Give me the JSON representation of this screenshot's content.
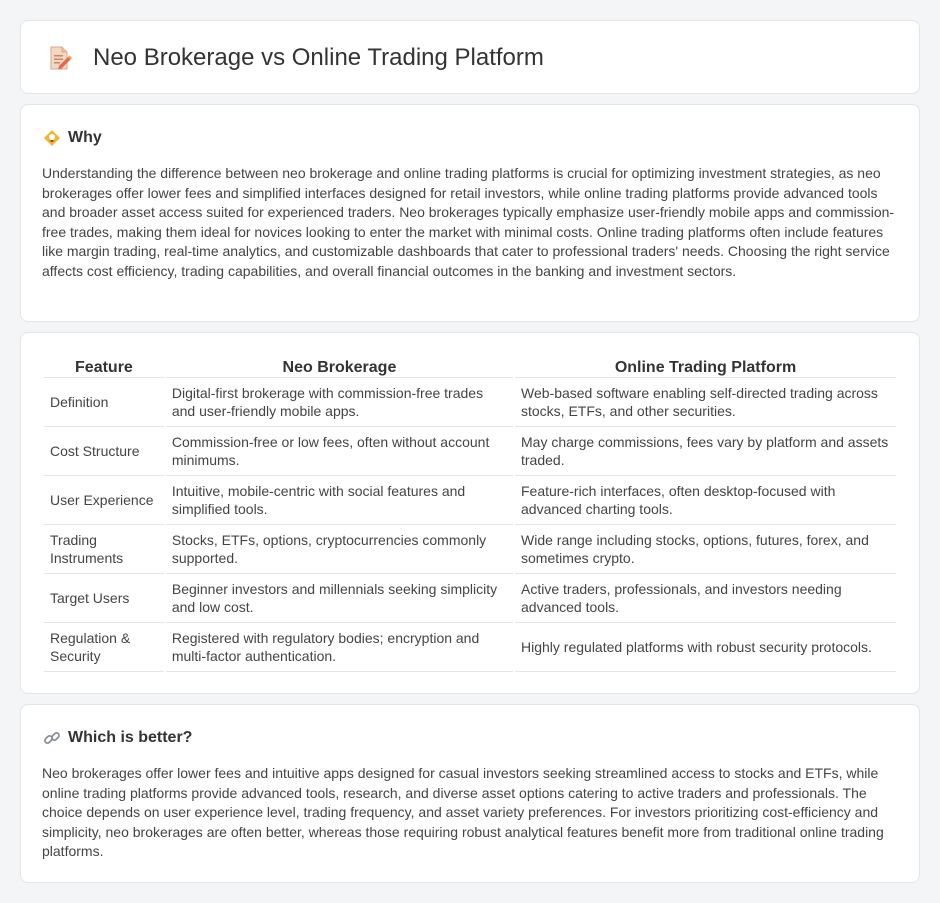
{
  "header": {
    "title": "Neo Brokerage vs Online Trading Platform",
    "icon": "document-edit-icon"
  },
  "why": {
    "heading": "Why",
    "icon": "bulb-icon",
    "text": "Understanding the difference between neo brokerage and online trading platforms is crucial for optimizing investment strategies, as neo brokerages offer lower fees and simplified interfaces designed for retail investors, while online trading platforms provide advanced tools and broader asset access suited for experienced traders. Neo brokerages typically emphasize user-friendly mobile apps and commission-free trades, making them ideal for novices looking to enter the market with minimal costs. Online trading platforms often include features like margin trading, real-time analytics, and customizable dashboards that cater to professional traders' needs. Choosing the right service affects cost efficiency, trading capabilities, and overall financial outcomes in the banking and investment sectors."
  },
  "table": {
    "columns": [
      "Feature",
      "Neo Brokerage",
      "Online Trading Platform"
    ],
    "rows": [
      [
        "Definition",
        "Digital-first brokerage with commission-free trades and user-friendly mobile apps.",
        "Web-based software enabling self-directed trading across stocks, ETFs, and other securities."
      ],
      [
        "Cost Structure",
        "Commission-free or low fees, often without account minimums.",
        "May charge commissions, fees vary by platform and assets traded."
      ],
      [
        "User Experience",
        "Intuitive, mobile-centric with social features and simplified tools.",
        "Feature-rich interfaces, often desktop-focused with advanced charting tools."
      ],
      [
        "Trading Instruments",
        "Stocks, ETFs, options, cryptocurrencies commonly supported.",
        "Wide range including stocks, options, futures, forex, and sometimes crypto."
      ],
      [
        "Target Users",
        "Beginner investors and millennials seeking simplicity and low cost.",
        "Active traders, professionals, and investors needing advanced tools."
      ],
      [
        "Regulation & Security",
        "Registered with regulatory bodies; encryption and multi-factor authentication.",
        "Highly regulated platforms with robust security protocols."
      ]
    ]
  },
  "better": {
    "heading": "Which is better?",
    "icon": "link-icon",
    "text": "Neo brokerages offer lower fees and intuitive apps designed for casual investors seeking streamlined access to stocks and ETFs, while online trading platforms provide advanced tools, research, and diverse asset options catering to active traders and professionals. The choice depends on user experience level, trading frequency, and asset variety preferences. For investors prioritizing cost-efficiency and simplicity, neo brokerages are often better, whereas those requiring robust analytical features benefit more from traditional online trading platforms."
  }
}
